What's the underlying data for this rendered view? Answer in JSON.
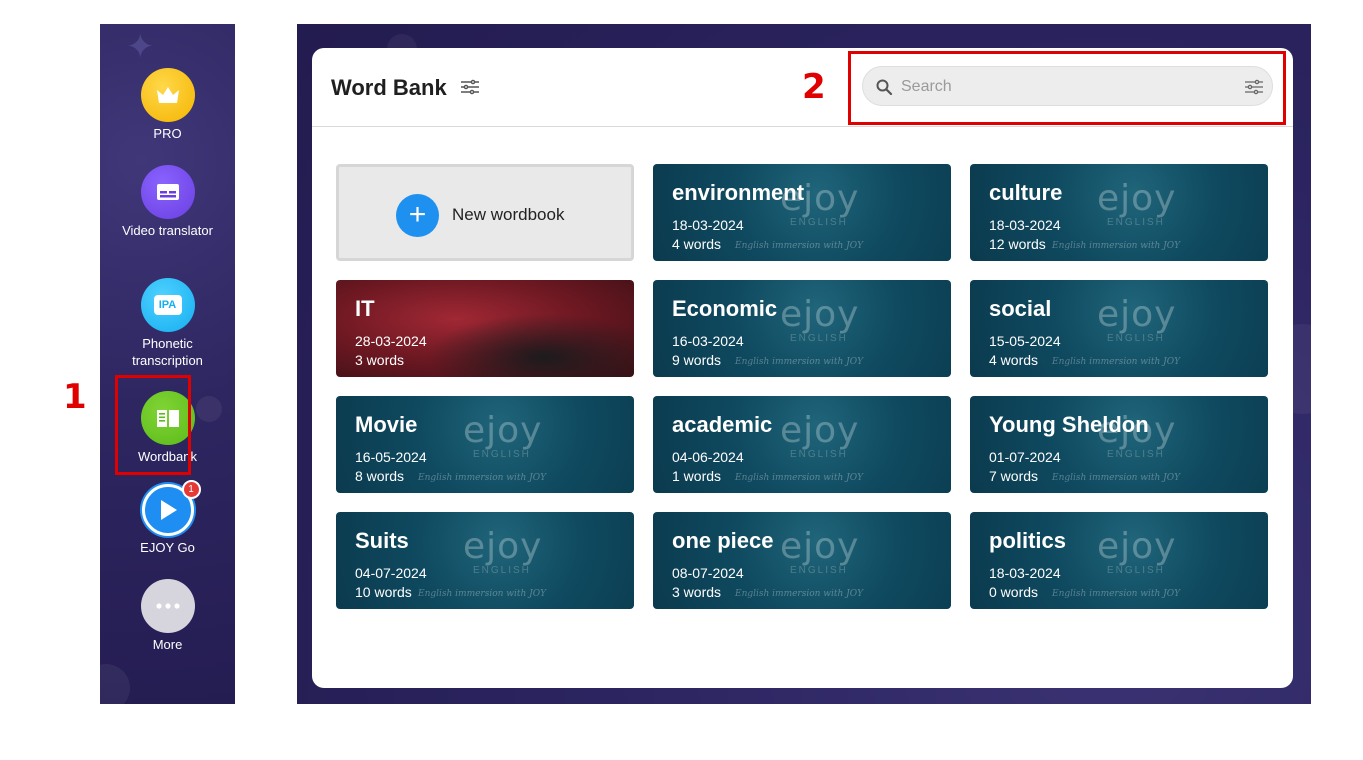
{
  "sidebar": {
    "items": [
      {
        "label": "PRO",
        "icon": "crown-icon"
      },
      {
        "label": "Video translator",
        "icon": "subtitles-icon"
      },
      {
        "label": "Phonetic transcription",
        "icon": "ipa-icon",
        "chip": "IPA"
      },
      {
        "label": "Wordbank",
        "icon": "book-icon"
      },
      {
        "label": "EJOY Go",
        "icon": "play-icon",
        "badge": "1"
      },
      {
        "label": "More",
        "icon": "more-dots-icon"
      }
    ]
  },
  "annotations": {
    "one": "1",
    "two": "2"
  },
  "header": {
    "title": "Word Bank",
    "search_placeholder": "Search"
  },
  "new_wordbook": {
    "label": "New wordbook"
  },
  "watermark": {
    "logo": "ejoy",
    "sub": "ENGLISH",
    "tagline": "English immersion with JOY"
  },
  "wordbooks": [
    {
      "name": "environment",
      "date": "18-03-2024",
      "words": "4 words"
    },
    {
      "name": "culture",
      "date": "18-03-2024",
      "words": "12 words"
    },
    {
      "name": "IT",
      "date": "28-03-2024",
      "words": "3 words"
    },
    {
      "name": "Economic",
      "date": "16-03-2024",
      "words": "9 words"
    },
    {
      "name": "social",
      "date": "15-05-2024",
      "words": "4 words"
    },
    {
      "name": "Movie",
      "date": "16-05-2024",
      "words": "8 words"
    },
    {
      "name": "academic",
      "date": "04-06-2024",
      "words": "1 words"
    },
    {
      "name": "Young Sheldon",
      "date": "01-07-2024",
      "words": "7 words"
    },
    {
      "name": "Suits",
      "date": "04-07-2024",
      "words": "10 words"
    },
    {
      "name": "one piece",
      "date": "08-07-2024",
      "words": "3 words"
    },
    {
      "name": "politics",
      "date": "18-03-2024",
      "words": "0 words"
    }
  ],
  "colors": {
    "annotation": "#e00000",
    "accent": "#1e90f0",
    "card": "#0f4a60"
  }
}
